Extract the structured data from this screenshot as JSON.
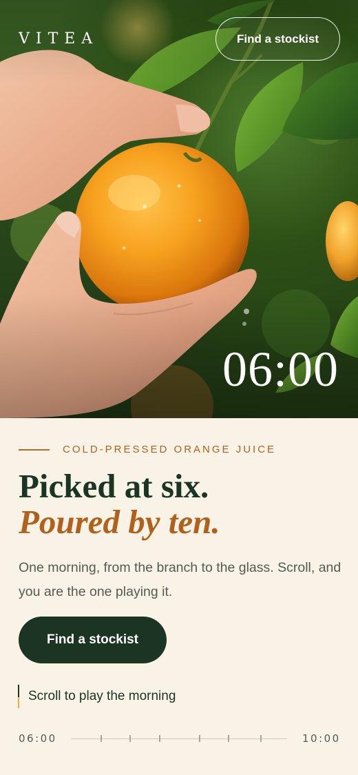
{
  "brand": "VITEA",
  "nav": {
    "cta_label": "Find a stockist"
  },
  "hero": {
    "time": "06:00"
  },
  "section": {
    "eyebrow": "COLD-PRESSED ORANGE JUICE",
    "headline_line1": "Picked at six.",
    "headline_line2": "Poured by ten.",
    "lead": "One morning, from the branch to the glass. Scroll, and you are the one playing it.",
    "cta_label": "Find a stockist",
    "scroll_hint": "Scroll to play the morning"
  },
  "timeline": {
    "start_label": "06:00",
    "end_label": "10:00",
    "tick_count": 7,
    "progress": 0
  },
  "colors": {
    "forest": "#1c3424",
    "amber": "#b0621c",
    "cream": "#f8f2e7",
    "orange": "#f39a1d"
  }
}
